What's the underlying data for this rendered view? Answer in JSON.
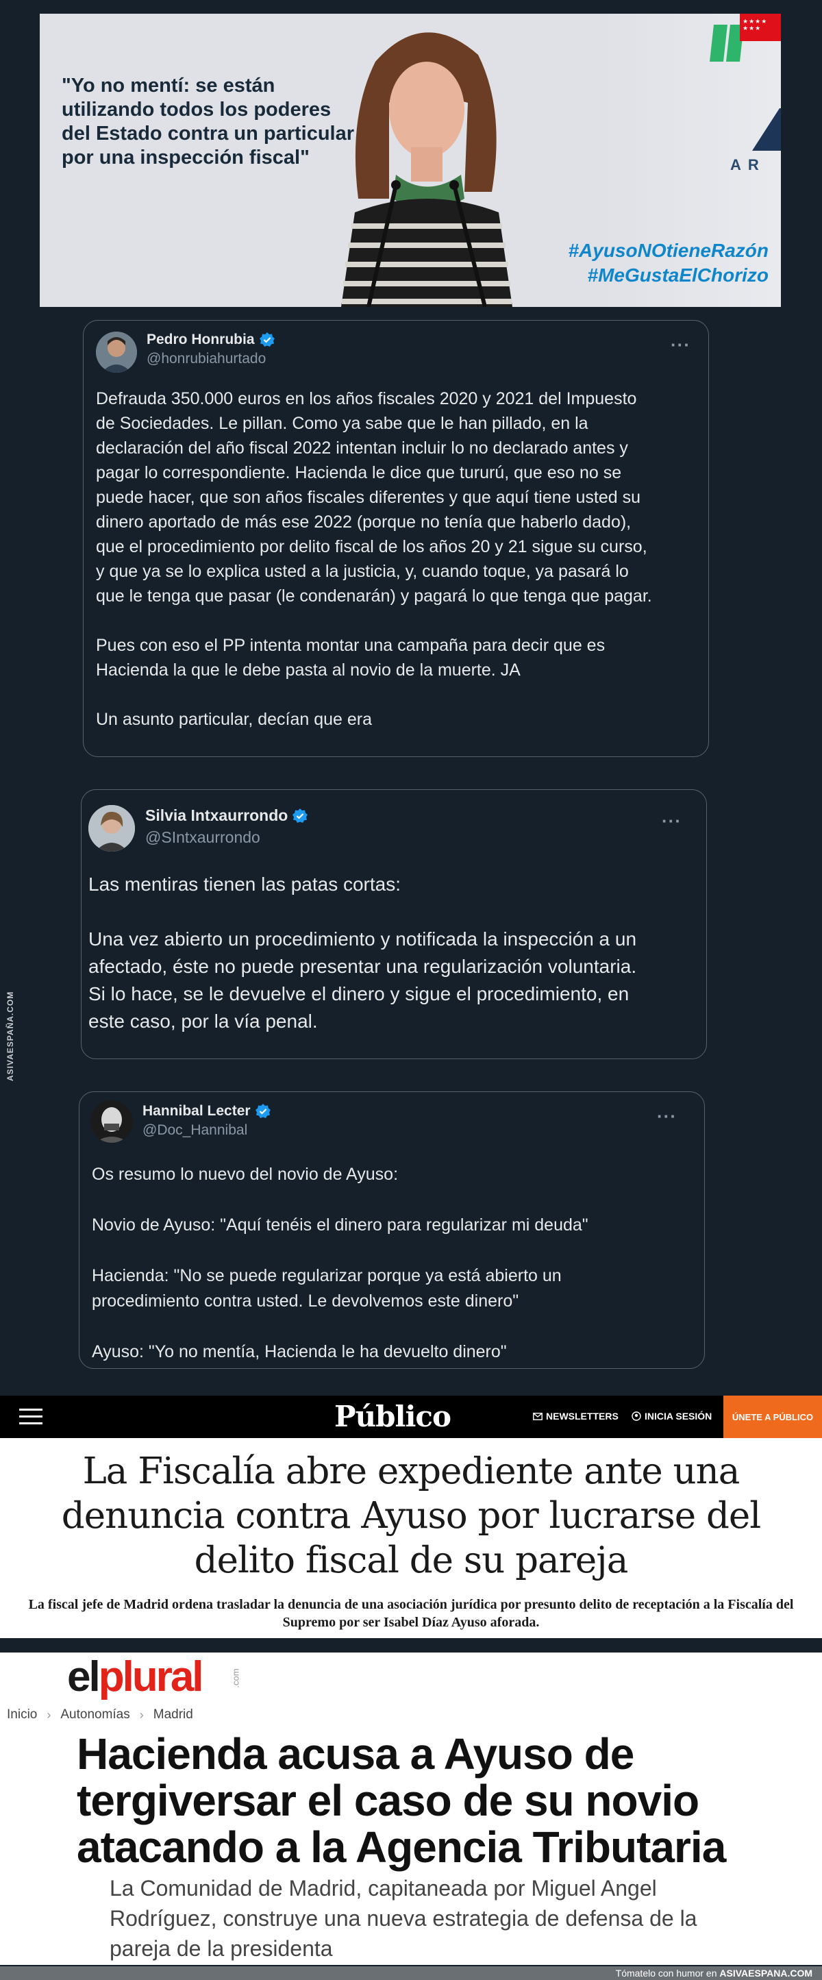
{
  "banner": {
    "quote": "\"Yo no mentí: se están utilizando todos los poderes del Estado contra un particular por una inspección fiscal\"",
    "hashtags": [
      "#AyusoNOtieneRazón",
      "#MeGustaElChorizo"
    ],
    "wordmark": "AR"
  },
  "tweets": [
    {
      "name": "Pedro Honrubia",
      "handle": "@honrubiahurtado",
      "more": "···",
      "text": "Defrauda 350.000 euros en los años fiscales 2020 y 2021 del Impuesto\nde Sociedades. Le pillan. Como ya sabe que le han pillado, en la\ndeclaración del año fiscal 2022 intentan incluir lo no declarado antes y\npagar lo correspondiente. Hacienda le dice que tururú, que eso no se\npuede hacer, que son años fiscales diferentes y que aquí tiene usted su\ndinero aportado de más ese 2022 (porque no tenía que haberlo dado),\nque el procedimiento por delito fiscal de los años 20 y 21 sigue su curso,\ny que ya se lo explica usted a la justicia, y, cuando toque, ya pasará lo\nque le tenga que pasar (le condenarán) y pagará lo que tenga que pagar.\n\nPues con eso el PP intenta montar una campaña para decir que es\nHacienda la que le debe pasta al novio de la muerte. JA\n\nUn asunto particular, decían que era"
    },
    {
      "name": "Silvia Intxaurrondo",
      "handle": "@SIntxaurrondo",
      "more": "···",
      "text": "Las mentiras tienen las patas cortas:\n\nUna vez abierto un procedimiento y notificada la inspección a un\nafectado, éste no puede presentar una regularización voluntaria.\nSi lo hace, se le devuelve el dinero y sigue el procedimiento, en\neste caso, por la vía penal."
    },
    {
      "name": "Hannibal Lecter",
      "handle": "@Doc_Hannibal",
      "more": "···",
      "text": "Os resumo lo nuevo del novio de Ayuso:\n\nNovio de Ayuso: \"Aquí tenéis el dinero para regularizar mi deuda\"\n\nHacienda: \"No se puede regularizar porque ya está abierto un\nprocedimiento contra usted. Le devolvemos este dinero\"\n\nAyuso: \"Yo no mentía, Hacienda le ha devuelto dinero\""
    }
  ],
  "publico": {
    "logo": "Público",
    "nav_newsletters": "NEWSLETTERS",
    "nav_login": "INICIA SESIÓN",
    "join": "ÚNETE A PÚBLICO",
    "headline": "La Fiscalía abre expediente ante una denuncia contra Ayuso por lucrarse del delito fiscal de su pareja",
    "subhead": "La fiscal jefe de Madrid ordena trasladar la denuncia de una asociación jurídica por presunto delito de receptación a la Fiscalía del Supremo por ser Isabel Díaz Ayuso aforada."
  },
  "elplural": {
    "logo_el": "el",
    "logo_plural": "plural",
    "logo_com": ".com",
    "breadcrumb": [
      "Inicio",
      "Autonomías",
      "Madrid"
    ],
    "headline": "Hacienda acusa a Ayuso de tergiversar el caso de su novio atacando a la Agencia Tributaria",
    "subhead": "La Comunidad de Madrid, capitaneada por Miguel Angel Rodríguez, construye una nueva estrategia de defensa de la pareja de la presidenta"
  },
  "watermark": {
    "side": "ASIVAESPAÑA.COM",
    "footer_lead": "Tómatelo con humor en",
    "footer_site": "ASIVAESPANA.COM"
  },
  "colors": {
    "background": "#16202a",
    "verified": "#1d9bf0",
    "hashtag": "#0e86c9",
    "publico_accent": "#f06a1d",
    "elplural_red": "#e2231a"
  }
}
